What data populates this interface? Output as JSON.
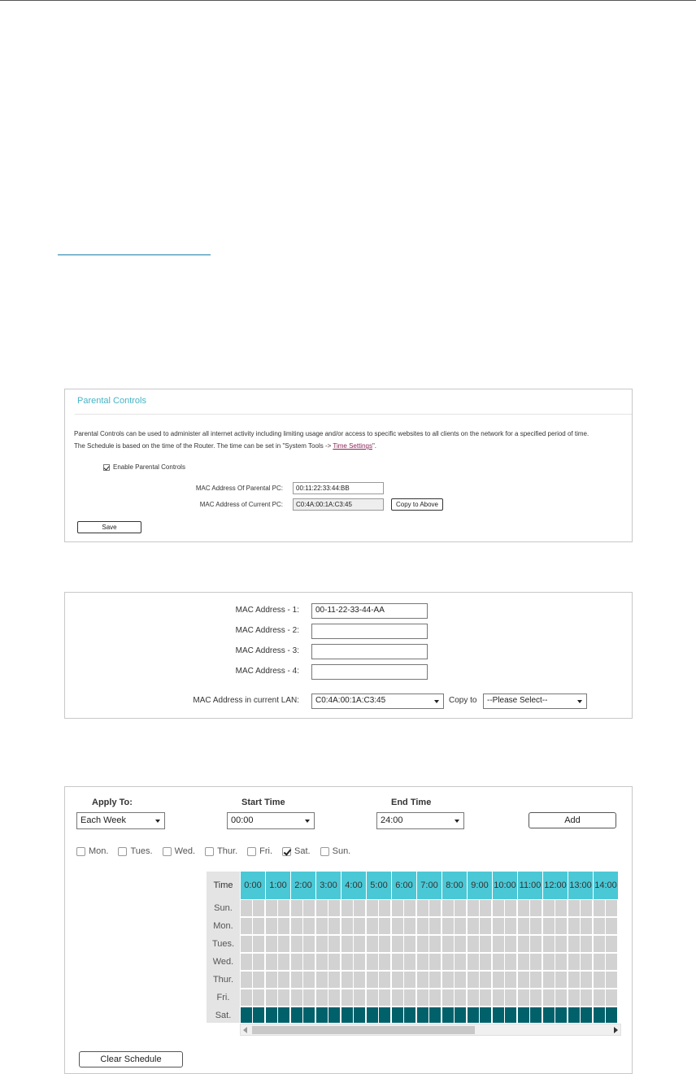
{
  "parental": {
    "title": "Parental Controls",
    "desc_line1": "Parental Controls can be used to administer all internet activity including limiting usage and/or access to specific websites to all clients on the network for a specified period of time.",
    "desc_line2_prefix": "The Schedule is based on the time of the Router. The time can be set in \"System Tools -> ",
    "desc_link": " Time Settings",
    "desc_line2_suffix": "\".",
    "enable_label": "Enable Parental Controls",
    "enable_checked": true,
    "mac_parental_label": "MAC Address Of Parental PC:",
    "mac_parental_value": "00:11:22:33:44:BB",
    "mac_current_label": "MAC Address of Current PC:",
    "mac_current_value": "C0:4A:00:1A:C3:45",
    "copy_button": "Copy to Above",
    "save_button": "Save"
  },
  "mac_list": {
    "labels": [
      "MAC Address - 1:",
      "MAC Address - 2:",
      "MAC Address - 3:",
      "MAC Address - 4:"
    ],
    "values": [
      "00-11-22-33-44-AA",
      "",
      "",
      ""
    ],
    "lan_label": "MAC Address in current LAN:",
    "lan_value": "C0:4A:00:1A:C3:45",
    "copy_to_label": "Copy to",
    "copy_to_value": "--Please Select--"
  },
  "schedule": {
    "apply_to_label": "Apply To:",
    "apply_to_value": "Each Week",
    "start_time_label": "Start Time",
    "start_time_value": "00:00",
    "end_time_label": "End Time",
    "end_time_value": "24:00",
    "add_button": "Add",
    "days": [
      {
        "label": "Mon.",
        "checked": false
      },
      {
        "label": "Tues.",
        "checked": false
      },
      {
        "label": "Wed.",
        "checked": false
      },
      {
        "label": "Thur.",
        "checked": false
      },
      {
        "label": "Fri.",
        "checked": false
      },
      {
        "label": "Sat.",
        "checked": true
      },
      {
        "label": "Sun.",
        "checked": false
      }
    ],
    "grid_header_label": "Time",
    "hours": [
      "0:00",
      "1:00",
      "2:00",
      "3:00",
      "4:00",
      "5:00",
      "6:00",
      "7:00",
      "8:00",
      "9:00",
      "10:00",
      "11:00",
      "12:00",
      "13:00",
      "14:00"
    ],
    "grid_days": [
      "Sun.",
      "Mon.",
      "Tues.",
      "Wed.",
      "Thur.",
      "Fri.",
      "Sat."
    ],
    "active_days": [
      "Sat."
    ],
    "active_color": "#00616b",
    "header_color": "#4ac8d6",
    "clear_button": "Clear Schedule"
  }
}
